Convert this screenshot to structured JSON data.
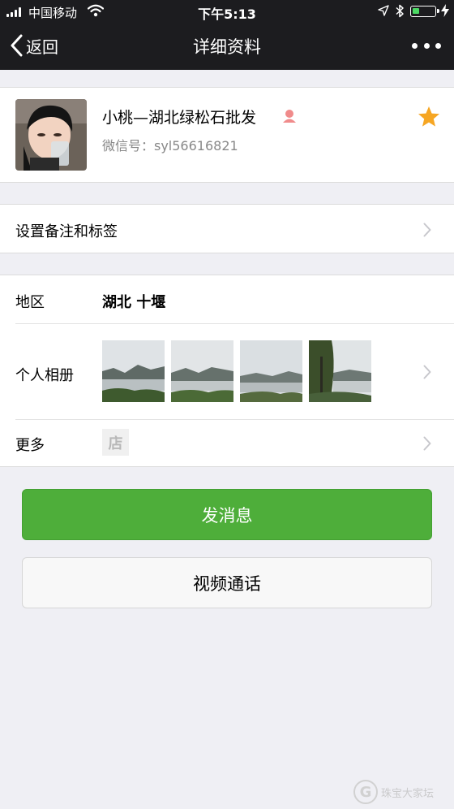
{
  "status_bar": {
    "carrier": "中国移动",
    "time": "下午5:13",
    "battery_color": "#4cd964"
  },
  "nav": {
    "back_label": "返回",
    "title": "详细资料",
    "back_icon": "chevron-left-icon",
    "more_icon": "more-dots-icon"
  },
  "profile": {
    "name": "小桃—湖北绿松石批发",
    "wechat_id": "微信号：syl56616821",
    "gender_icon": "female-icon",
    "gender_color": "#f08b8b",
    "star_icon": "star-icon",
    "star_color": "#f6a623"
  },
  "remark_row": {
    "label": "设置备注和标签"
  },
  "info": {
    "region_label": "地区",
    "region_value": "湖北 十堰",
    "album_label": "个人相册",
    "album_count": 4,
    "more_label": "更多",
    "shop_icon_text": "店"
  },
  "buttons": {
    "message": "发消息",
    "video_call": "视频通话",
    "primary_color": "#4eae3a"
  },
  "watermark": {
    "text": "珠宝大家坛"
  }
}
